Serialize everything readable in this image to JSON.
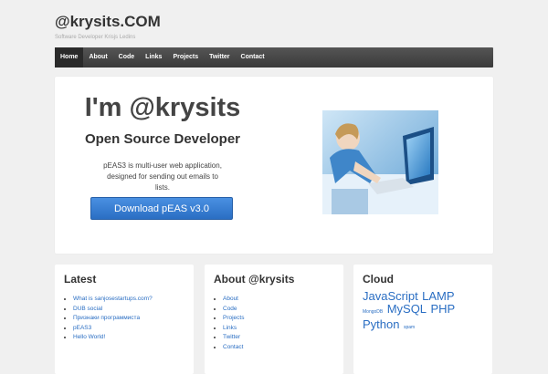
{
  "site": {
    "title": "@krysits.COM",
    "description": "Software Developer Krisjs Ledins"
  },
  "nav": [
    "Home",
    "About",
    "Code",
    "Links",
    "Projects",
    "Twitter",
    "Contact"
  ],
  "hero": {
    "title": "I'm @krysits",
    "subtitle": "Open Source Developer",
    "text": "pEAS3 is multi-user web application, designed for sending out emails to lists.",
    "button": "Download pEAS v3.0"
  },
  "latest": {
    "title": "Latest",
    "items": [
      "What is sanjosestartups.com?",
      "DUB social",
      "Признаки программиста",
      "pEAS3",
      "Hello World!"
    ]
  },
  "about": {
    "title": "About @krysits",
    "items": [
      "About",
      "Code",
      "Projects",
      "Links",
      "Twitter",
      "Contact"
    ]
  },
  "cloud": {
    "title": "Cloud",
    "tags": [
      "JavaScript",
      "LAMP",
      "MongoDB",
      "MySQL",
      "PHP",
      "Python",
      "spam"
    ]
  },
  "colors": {
    "accent": "#2a6ec3",
    "nav": "#3a3a3a"
  }
}
